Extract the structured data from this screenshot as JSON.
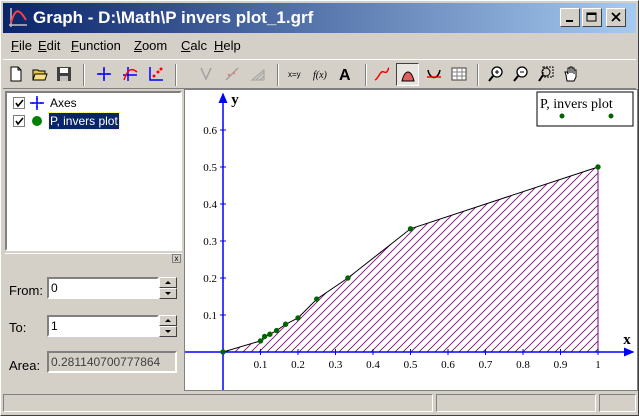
{
  "window": {
    "title": "Graph - D:\\Math\\P invers plot_1.grf"
  },
  "menu": [
    "File",
    "Edit",
    "Function",
    "Zoom",
    "Calc",
    "Help"
  ],
  "toolbar": {
    "buttons": [
      "new-icon",
      "open-icon",
      "save-icon",
      "axes-icon",
      "insert-function-icon",
      "insert-point-series-icon",
      "trendline-icon",
      "insert-shade-icon",
      "relation-icon",
      "inequality-icon",
      "insert-label-icon",
      "function-icon",
      "text-icon",
      "evaluate-icon",
      "area-icon",
      "tangent-icon",
      "table-icon",
      "zoom-in-icon",
      "zoom-out-icon",
      "zoom-square-icon",
      "move-hand-icon"
    ],
    "pressed": "area-icon"
  },
  "tree": {
    "items": [
      {
        "label": "Axes",
        "checked": true,
        "icon": "axes-icon"
      },
      {
        "label": "P, invers plot",
        "checked": true,
        "icon": "green-dot-icon",
        "selected": true
      }
    ]
  },
  "calc": {
    "from_label": "From:",
    "from_value": "0",
    "to_label": "To:",
    "to_value": "1",
    "area_label": "Area:",
    "area_value": "0.281140700777864"
  },
  "plot": {
    "legend": "P, invers plot",
    "colors": {
      "axes": "#0000ff",
      "line": "#000000",
      "points": "#006400",
      "hatch": "#800080"
    }
  },
  "chart_data": {
    "type": "line",
    "series": [
      {
        "name": "P, invers plot",
        "x": [
          0,
          0.1,
          0.111,
          0.125,
          0.143,
          0.167,
          0.2,
          0.25,
          0.333,
          0.5,
          1
        ],
        "y": [
          0,
          0.03,
          0.042,
          0.048,
          0.058,
          0.075,
          0.092,
          0.143,
          0.2,
          0.333,
          0.5
        ]
      }
    ],
    "shaded_area": {
      "from": 0,
      "to": 1,
      "area": 0.281140700777864
    },
    "xlabel": "x",
    "ylabel": "y",
    "xlim": [
      -0.1,
      1.05
    ],
    "ylim": [
      -0.1,
      0.68
    ],
    "xticks": [
      "0.1",
      "0.2",
      "0.3",
      "0.4",
      "0.5",
      "0.6",
      "0.7",
      "0.8",
      "0.9",
      "1"
    ],
    "yticks": [
      "0.1",
      "0.2",
      "0.3",
      "0.4",
      "0.5",
      "0.6"
    ],
    "legend_position": "top-right",
    "grid": false
  }
}
